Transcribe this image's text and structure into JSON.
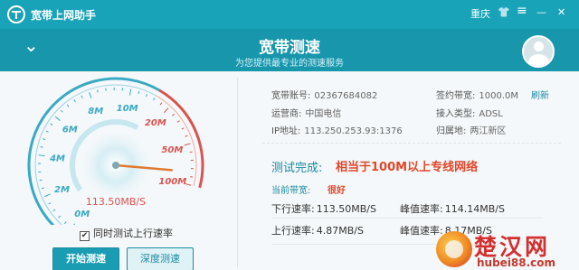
{
  "titlebar": {
    "app_title": "宽带上网助手",
    "city": "重庆",
    "icons": [
      "logo-icon",
      "shirt-icon",
      "menu-icon",
      "minimize-icon",
      "close-icon"
    ],
    "shirt_glyph": "👕",
    "menu_glyph": "≡",
    "min_glyph": "—",
    "close_glyph": "✕"
  },
  "header": {
    "chevron": "⌄",
    "title": "宽带测速",
    "subtitle": "为您提供最专业的测速服务"
  },
  "gauge": {
    "labels": [
      "0M",
      "2M",
      "4M",
      "6M",
      "8M",
      "10M",
      "20M",
      "50M",
      "100M"
    ],
    "reading": "113.50MB/S",
    "needle_fraction": 0.96,
    "colors": {
      "blue": "#3aa9c4",
      "red": "#d9534f",
      "needle": "#e07a30"
    }
  },
  "left_controls": {
    "upload_check_label": "同时测试上行速率",
    "upload_checked": true,
    "check_glyph": "✔",
    "start_button": "开始测速",
    "deep_button": "深度测速"
  },
  "info": {
    "account_label": "宽带账号:",
    "account_value": "02367684082",
    "contract_label": "签约带宽:",
    "contract_value": "1000.0M",
    "refresh": "刷新",
    "isp_label": "运营商:",
    "isp_value": "中国电信",
    "access_label": "接入类型:",
    "access_value": "ADSL",
    "ip_label": "IP地址:",
    "ip_value": "113.250.253.93:1376",
    "location_label": "归属地:",
    "location_value": "两江新区"
  },
  "result": {
    "done_label": "测试完成:",
    "done_message": "相当于100M以上专线网络",
    "bandwidth_label": "当前带宽:",
    "bandwidth_value": "很好",
    "down_label": "下行速率:",
    "down_value": "113.50MB/S",
    "down_peak_label": "峰值速率:",
    "down_peak_value": "114.14MB/S",
    "up_label": "上行速率:",
    "up_value": "4.87MB/S",
    "up_peak_label": "峰值速率:",
    "up_peak_value": "8.17MB/S"
  },
  "watermark": {
    "text": "楚汉网",
    "url": "hubei88.com"
  },
  "colors": {
    "brand": "#19a3b8",
    "accent_red": "#e0472a"
  }
}
